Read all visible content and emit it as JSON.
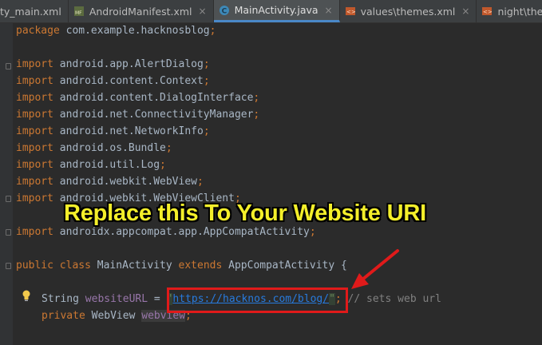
{
  "tabs": [
    {
      "label": "ty_main.xml",
      "icon": "layout-file-icon",
      "closable": false
    },
    {
      "label": "AndroidManifest.xml",
      "icon": "manifest-file-icon",
      "closable": true
    },
    {
      "label": "MainActivity.java",
      "icon": "java-class-icon",
      "closable": true,
      "active": true
    },
    {
      "label": "values\\themes.xml",
      "icon": "xml-file-icon",
      "closable": true
    },
    {
      "label": "night\\themes.xml",
      "icon": "xml-file-icon",
      "closable": true
    }
  ],
  "code": {
    "package_kw": "package",
    "package_name": " com.example.hacknosblog",
    "semicolon": ";",
    "import_kw": "import",
    "imports": [
      " android.app.AlertDialog",
      " android.content.Context",
      " android.content.DialogInterface",
      " android.net.ConnectivityManager",
      " android.net.NetworkInfo",
      " android.os.Bundle",
      " android.util.Log",
      " android.webkit.WebView",
      " android.webkit.WebViewClient",
      " androidx.appcompat.app.AppCompatActivity"
    ],
    "class_line": {
      "public_kw": "public",
      "class_kw": " class",
      "class_name": " MainActivity",
      "extends_kw": " extends",
      "parent": " AppCompatActivity {"
    },
    "field_line": {
      "type": "String",
      "name": "websiteURL",
      "assign": " = ",
      "quote_open": "\"",
      "url": "https://hacknos.com/blog/",
      "quote_close": "\"",
      "comment": "// sets web url"
    },
    "webview_line": {
      "private_kw": "private",
      "type": " WebView ",
      "name": "webview"
    }
  },
  "annotation": {
    "text": "Replace this To Your Website URI",
    "text_color": "#f4ef2a",
    "box_color": "#e01a1a"
  },
  "theme": {
    "background": "#2b2b2b",
    "keyword": "#cc7832",
    "field": "#9876aa",
    "string": "#6a8759",
    "comment": "#808080",
    "active_tab_underline": "#4a88c7"
  }
}
